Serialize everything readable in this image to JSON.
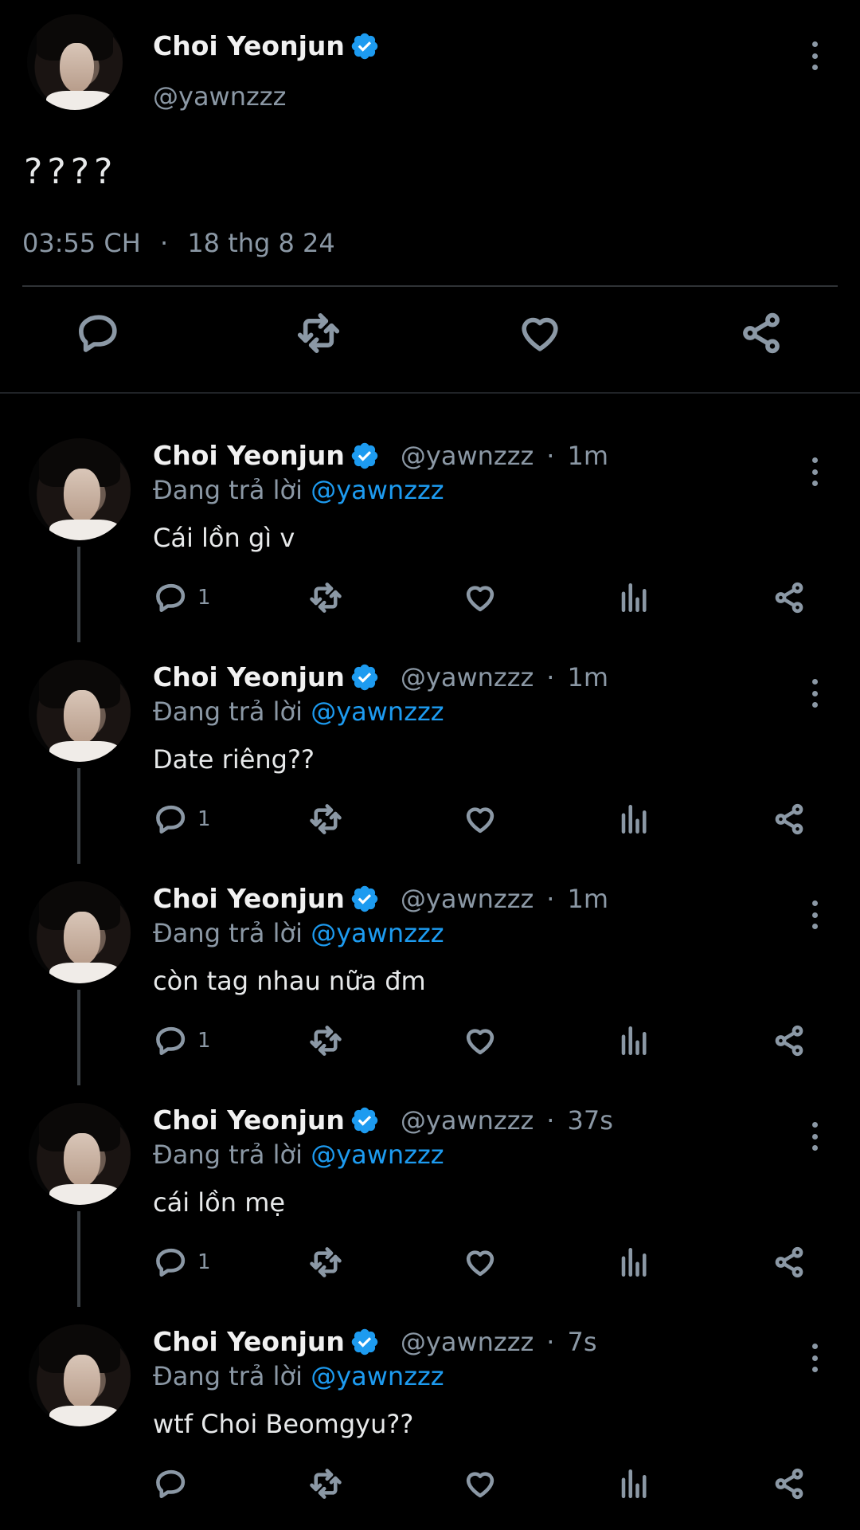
{
  "main_tweet": {
    "author_name": "Choi Yeonjun",
    "handle": "@yawnzzz",
    "text": "????",
    "time": "03:55 CH",
    "date": "18 thg 8 24"
  },
  "colors": {
    "background": "#000000",
    "verified": "#1d9bf0",
    "link": "#1d9bf0",
    "muted": "#8b98a5"
  },
  "icons": {
    "reply": "reply-icon",
    "retweet": "retweet-icon",
    "like": "heart-icon",
    "views": "views-icon",
    "share": "share-icon",
    "more": "more-icon",
    "verified": "verified-badge-icon"
  },
  "replies": [
    {
      "author_name": "Choi Yeonjun",
      "handle": "@yawnzzz",
      "time": "1m",
      "replying_label": "Đang trả lời",
      "replying_to": "@yawnzzz",
      "text": "Cái lồn gì v",
      "reply_count": "1"
    },
    {
      "author_name": "Choi Yeonjun",
      "handle": "@yawnzzz",
      "time": "1m",
      "replying_label": "Đang trả lời",
      "replying_to": "@yawnzzz",
      "text": "Date riêng??",
      "reply_count": "1"
    },
    {
      "author_name": "Choi Yeonjun",
      "handle": "@yawnzzz",
      "time": "1m",
      "replying_label": "Đang trả lời",
      "replying_to": "@yawnzzz",
      "text": "còn tag nhau nữa đm",
      "reply_count": "1"
    },
    {
      "author_name": "Choi Yeonjun",
      "handle": "@yawnzzz",
      "time": "37s",
      "replying_label": "Đang trả lời",
      "replying_to": "@yawnzzz",
      "text": "cái lồn mẹ",
      "reply_count": "1"
    },
    {
      "author_name": "Choi Yeonjun",
      "handle": "@yawnzzz",
      "time": "7s",
      "replying_label": "Đang trả lời",
      "replying_to": "@yawnzzz",
      "text": "wtf Choi Beomgyu??",
      "reply_count": ""
    }
  ]
}
